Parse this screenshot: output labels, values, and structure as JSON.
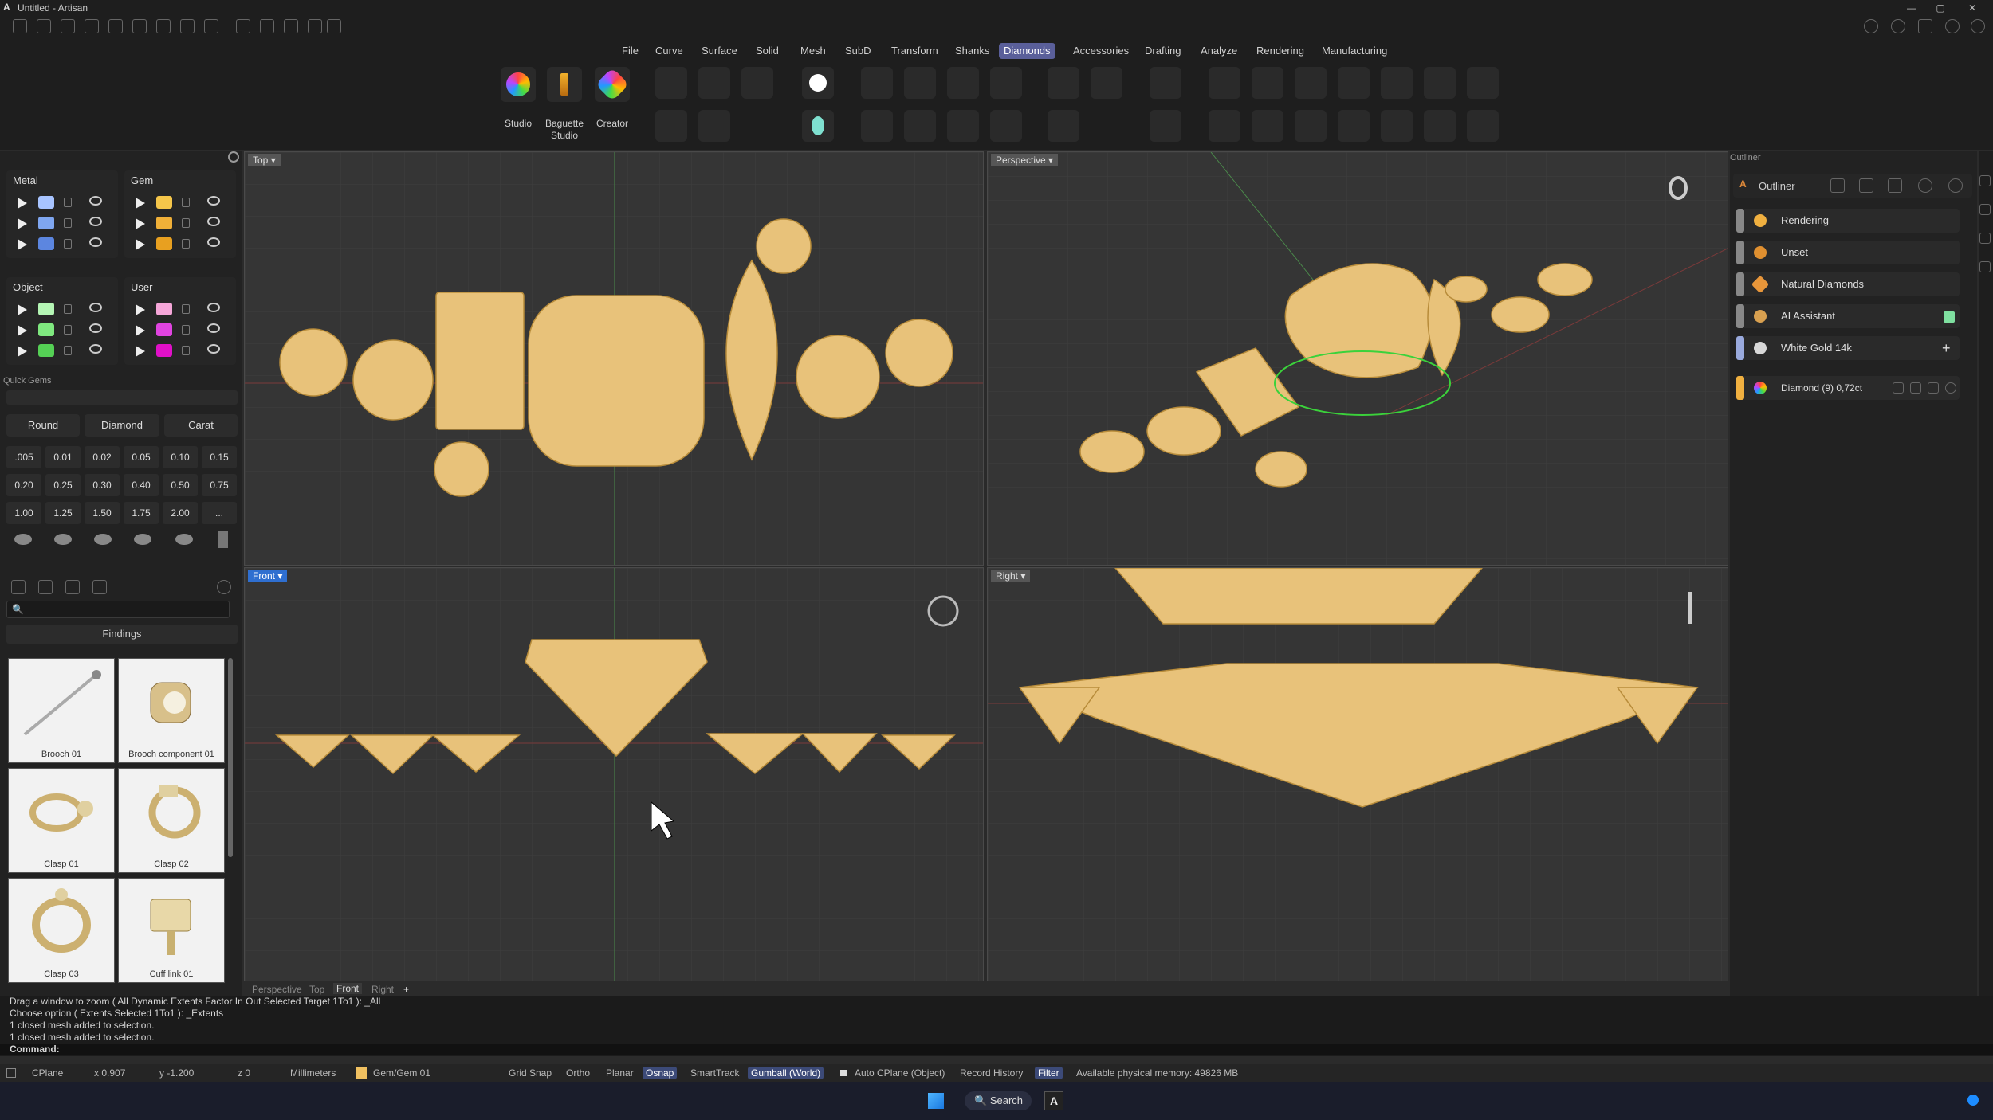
{
  "window": {
    "title": "Untitled - Artisan",
    "logo": "A"
  },
  "menu": [
    "File",
    "Curve",
    "Surface",
    "Solid",
    "Mesh",
    "SubD",
    "Transform",
    "Shanks",
    "Diamonds",
    "Accessories",
    "Drafting",
    "Analyze",
    "Rendering",
    "Manufacturing"
  ],
  "menu_active": "Diamonds",
  "ribbon": {
    "studio": "Studio",
    "baguette_line1": "Baguette",
    "baguette_line2": "Studio",
    "creator": "Creator"
  },
  "layers": {
    "metal": {
      "title": "Metal",
      "colors": [
        "#a8c4ff",
        "#7fa6f0",
        "#5c86e0"
      ]
    },
    "gem": {
      "title": "Gem",
      "colors": [
        "#f5c64a",
        "#f0b038",
        "#e8a020"
      ]
    },
    "object": {
      "title": "Object",
      "colors": [
        "#b4f5b4",
        "#7fe87f",
        "#55d055"
      ]
    },
    "user": {
      "title": "User",
      "colors": [
        "#f5a6d8",
        "#e044e0",
        "#e010c8"
      ]
    }
  },
  "quick_gems": {
    "title": "Quick Gems",
    "shape": "Round",
    "material": "Diamond",
    "unit": "Carat",
    "values": [
      ".005",
      "0.01",
      "0.02",
      "0.05",
      "0.10",
      "0.15",
      "0.20",
      "0.25",
      "0.30",
      "0.40",
      "0.50",
      "0.75",
      "1.00",
      "1.25",
      "1.50",
      "1.75",
      "2.00",
      "..."
    ]
  },
  "library": {
    "search_placeholder": "",
    "category": "Findings",
    "items": [
      "Brooch 01",
      "Brooch component 01",
      "Clasp 01",
      "Clasp 02",
      "Clasp 03",
      "Cuff link 01"
    ]
  },
  "viewports": {
    "top": "Top",
    "perspective": "Perspective",
    "front": "Front",
    "right": "Right"
  },
  "viewport_tabs": [
    "Perspective",
    "Top",
    "Front",
    "Right",
    "+"
  ],
  "outliner": {
    "panel_title": "Outliner",
    "title": "Outliner",
    "items": [
      {
        "label": "Rendering",
        "color": "#f0b040"
      },
      {
        "label": "Unset",
        "color": "#e09030"
      },
      {
        "label": "Natural Diamonds",
        "color": "#e8963a"
      },
      {
        "label": "AI Assistant",
        "color": "#d8a050"
      },
      {
        "label": "White Gold 14k",
        "color": "#c8c8c8"
      }
    ],
    "selected": "Diamond (9) 0,72ct"
  },
  "command": {
    "history": [
      "Drag a window to zoom ( All  Dynamic  Extents  Factor  In  Out  Selected  Target  1To1 ): _All",
      "Choose option ( Extents  Selected  1To1 ): _Extents",
      "1 closed mesh added to selection.",
      "1 closed mesh added to selection."
    ],
    "prompt": "Command:"
  },
  "status": {
    "cplane": "CPlane",
    "x": "x 0.907",
    "y": "y -1.200",
    "z": "z 0",
    "units": "Millimeters",
    "layer": "Gem/Gem 01",
    "grid_snap": "Grid Snap",
    "ortho": "Ortho",
    "planar": "Planar",
    "osnap": "Osnap",
    "smarttrack": "SmartTrack",
    "gumball": "Gumball (World)",
    "auto_cplane": "Auto CPlane (Object)",
    "record_history": "Record History",
    "filter": "Filter",
    "memory": "Available physical memory: 49826 MB"
  },
  "taskbar": {
    "search": "Search"
  }
}
